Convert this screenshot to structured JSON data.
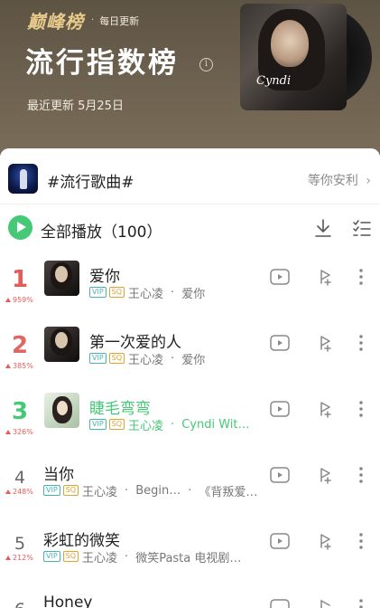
{
  "header": {
    "brand": "巅峰榜",
    "brand_sub": "每日更新",
    "title": "流行指数榜",
    "updated": "最近更新 5月25日",
    "cover_text": "Cyndi"
  },
  "tag": {
    "title": "#流行歌曲#",
    "link": "等你安利"
  },
  "play_all": {
    "label": "全部播放（100）"
  },
  "songs": [
    {
      "rank": "1",
      "change": "959%",
      "title": "爱你",
      "artist": "王心凌",
      "album": "爱你"
    },
    {
      "rank": "2",
      "change": "385%",
      "title": "第一次爱的人",
      "artist": "王心凌",
      "album": "爱你"
    },
    {
      "rank": "3",
      "change": "326%",
      "title": "睫毛弯弯",
      "artist": "王心凌",
      "album": "Cyndi Wit…"
    },
    {
      "rank": "4",
      "change": "248%",
      "title": "当你",
      "artist": "王心凌",
      "extra": "Begin…",
      "album": "《背叛爱…"
    },
    {
      "rank": "5",
      "change": "212%",
      "title": "彩虹的微笑",
      "artist": "王心凌",
      "album": "微笑Pasta 电视剧…"
    },
    {
      "rank": "6",
      "title": "Honey"
    }
  ],
  "colors": {
    "accent_green": "#45c976",
    "rank1": "#e55a5a",
    "rank2": "#e06565",
    "rank3": "#45c976",
    "vip": "#4bb2b3",
    "sq": "#e0a32e"
  }
}
